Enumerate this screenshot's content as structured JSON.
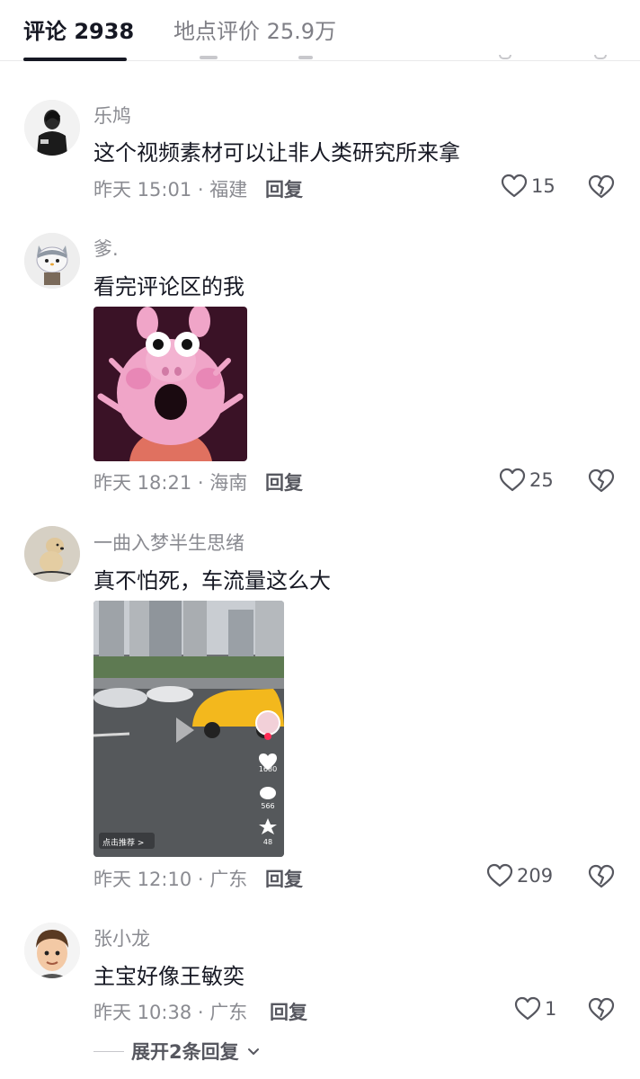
{
  "tabs": [
    {
      "label": "评论 2938"
    },
    {
      "label": "地点评价 25.9万"
    }
  ],
  "comments": [
    {
      "username": "乐鸠",
      "text": "这个视频素材可以让非人类研究所来拿",
      "meta": "昨天 15:01 · 福建",
      "reply_label": "回复",
      "likes": "15"
    },
    {
      "username": "爹.",
      "text": "看完评论区的我",
      "meta": "昨天 18:21 · 海南",
      "reply_label": "回复",
      "likes": "25"
    },
    {
      "username": "一曲入梦半生思绪",
      "text": "真不怕死，车流量这么大",
      "meta": "昨天 12:10 · 广东",
      "reply_label": "回复",
      "likes": "209",
      "video": {
        "heart_count": "1680",
        "comment_count": "566",
        "star_count": "48",
        "recommend_label": "点击推荐 >"
      }
    },
    {
      "username": "张小龙",
      "text": "主宝好像王敏奕",
      "meta": "昨天 10:38 · 广东",
      "reply_label": "回复",
      "likes": "1"
    }
  ],
  "expand_label": "展开2条回复"
}
